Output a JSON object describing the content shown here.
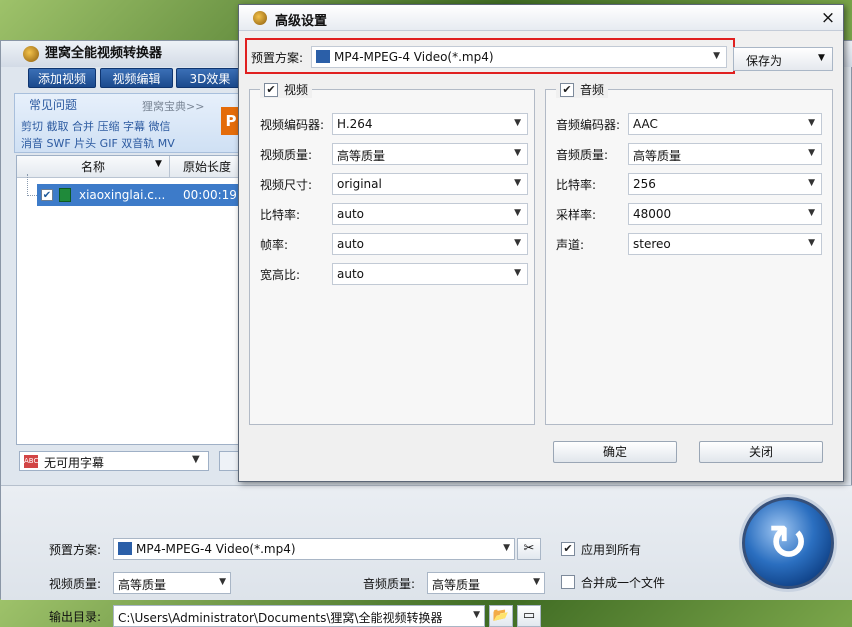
{
  "main": {
    "title": "狸窝全能视频转换器",
    "tabs": [
      "添加视频",
      "视频编辑",
      "3D效果"
    ],
    "faq": {
      "title": "常见问题",
      "more": "狸窝宝典>>",
      "row1": "剪切 截取 合并 压缩 字幕 微信",
      "row2": "消音 SWF 片头 GIF 双音轨 MV"
    },
    "ppt_icon": "P",
    "file_list": {
      "col_name": "名称",
      "col_duration": "原始长度",
      "rows": [
        {
          "name": "xiaoxinglai.c...",
          "duration": "00:00:19"
        }
      ]
    },
    "subtitle": "无可用字幕",
    "bottom": {
      "preset_label": "预置方案:",
      "preset_value": "MP4-MPEG-4 Video(*.mp4)",
      "apply_all": "应用到所有",
      "merge_one": "合并成一个文件",
      "video_quality_label": "视频质量:",
      "video_quality_value": "高等质量",
      "audio_quality_label": "音频质量:",
      "audio_quality_value": "高等质量",
      "output_label": "输出目录:",
      "output_value": "C:\\Users\\Administrator\\Documents\\狸窝\\全能视频转换器"
    }
  },
  "dialog": {
    "title": "高级设置",
    "close": "×",
    "preset_label": "预置方案:",
    "preset_value": "MP4-MPEG-4 Video(*.mp4)",
    "save_as": "保存为",
    "video": {
      "title": "视频",
      "fields": [
        {
          "label": "视频编码器:",
          "value": "H.264"
        },
        {
          "label": "视频质量:",
          "value": "高等质量"
        },
        {
          "label": "视频尺寸:",
          "value": "original"
        },
        {
          "label": "比特率:",
          "value": "auto"
        },
        {
          "label": "帧率:",
          "value": "auto"
        },
        {
          "label": "宽高比:",
          "value": "auto"
        }
      ]
    },
    "audio": {
      "title": "音频",
      "fields": [
        {
          "label": "音频编码器:",
          "value": "AAC"
        },
        {
          "label": "音频质量:",
          "value": "高等质量"
        },
        {
          "label": "比特率:",
          "value": "256"
        },
        {
          "label": "采样率:",
          "value": "48000"
        },
        {
          "label": "声道:",
          "value": "stereo"
        }
      ]
    },
    "ok": "确定",
    "cancel": "关闭"
  },
  "colors": {
    "highlight": "#e02020",
    "selection": "#3d7bc9",
    "tab": "#1b4a8d"
  }
}
